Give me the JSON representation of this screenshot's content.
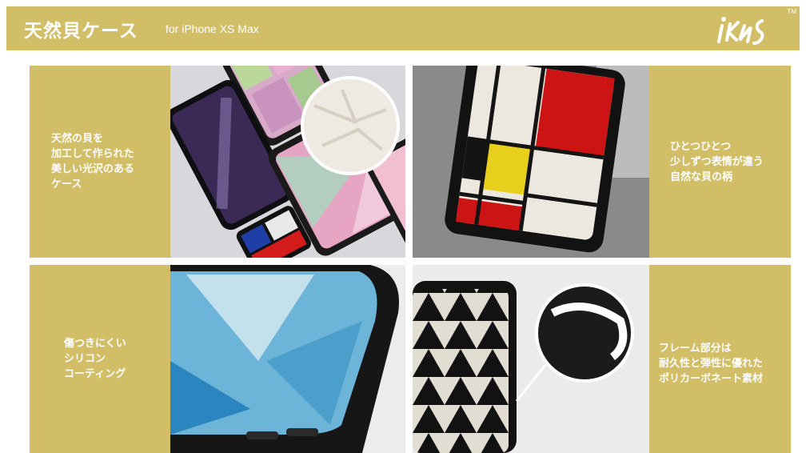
{
  "header": {
    "title": "天然貝ケース",
    "subtitle": "for iPhone XS Max",
    "logo_text": "iKins",
    "logo_tm": "TM"
  },
  "features": [
    {
      "lines": [
        "天然の貝を",
        "加工して作られた",
        "美しい光沢のある",
        "ケース"
      ]
    },
    {
      "lines": [
        "ひとつひとつ",
        "少しずつ表情が違う",
        "自然な貝の柄"
      ]
    },
    {
      "lines": [
        "傷つきにくい",
        "シリコン",
        "コーティング"
      ]
    },
    {
      "lines": [
        "フレーム部分は",
        "耐久性と弾性に優れた",
        "ポリカーボネート素材"
      ]
    }
  ],
  "colors": {
    "accent": "#d2be66",
    "text_on_accent": "#ffffff"
  }
}
